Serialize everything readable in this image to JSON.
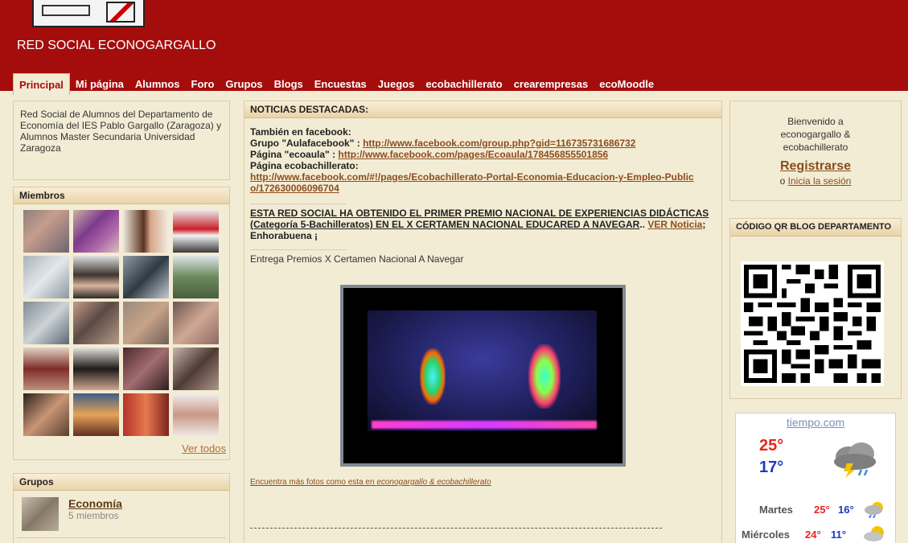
{
  "header": {
    "site_title": "RED SOCIAL ECONOGARGALLO"
  },
  "nav": {
    "tabs": [
      {
        "label": "Principal",
        "active": true
      },
      {
        "label": "Mi página"
      },
      {
        "label": "Alumnos"
      },
      {
        "label": "Foro"
      },
      {
        "label": "Grupos"
      },
      {
        "label": "Blogs"
      },
      {
        "label": "Encuestas"
      },
      {
        "label": "Juegos"
      },
      {
        "label": "ecobachillerato"
      },
      {
        "label": "crearempresas"
      },
      {
        "label": "ecoMoodle"
      }
    ]
  },
  "left": {
    "intro": "Red Social de Alumnos del Departamento de Economía del IES Pablo Gargallo (Zaragoza) y Alumnos Master Secundaria Universidad Zaragoza",
    "miembros_title": "Miembros",
    "ver_todos": "Ver todos",
    "grupos_title": "Grupos",
    "grupo": {
      "name": "Economía",
      "count": "5 miembros"
    }
  },
  "center": {
    "title": "NOTICIAS DESTACADAS:",
    "facebook_intro": "También en facebook:",
    "grupo_label": "Grupo \"Aulafacebook\" : ",
    "grupo_link": "http://www.facebook.com/group.php?gid=116735731686732",
    "pagina_label": "Página \"ecoaula\" : ",
    "pagina_link": "http://www.facebook.com/pages/Ecoaula/178456855501856",
    "ecobach_label": "Página ecobachillerato:",
    "ecobach_link": "http://www.facebook.com/#!/pages/Ecobachillerato-Portal-Economia-Educacion-y-Empleo-Publico/172630006096704",
    "dots": "......................................................",
    "premio": "ESTA RED SOCIAL HA OBTENIDO EL PRIMER PREMIO NACIONAL DE EXPERIENCIAS DIDÁCTICAS (Categoría 5-Bachilleratos) EN EL X CERTAMEN NACIONAL EDUCARED A NAVEGAR",
    "premio_sep": ".. ",
    "ver_noticia": "VER Noticia",
    "enhorabuena": "; Enhorabuena ¡",
    "entrega": "Entrega Premios X Certamen Nacional A Navegar",
    "mas_fotos_pre": "Encuentra más fotos como esta en ",
    "mas_fotos_site": "econogargallo & ecobachillerato"
  },
  "right": {
    "bienvenido_1": "Bienvenido a",
    "bienvenido_2": "econogargallo &",
    "bienvenido_3": "ecobachillerato",
    "registrarse": "Registrarse",
    "sesion_pre": "o ",
    "sesion_link": "Inicia la sesión",
    "qr_title": "CÓDIGO QR BLOG DEPARTAMENTO",
    "weather": {
      "site": "tiempo.com",
      "today_max": "25°",
      "today_min": "17°",
      "days": [
        {
          "name": "Martes",
          "max": "25°",
          "min": "16°"
        },
        {
          "name": "Miércoles",
          "max": "24°",
          "min": "11°"
        }
      ],
      "color_max": "#e8241f",
      "color_min": "#1e37c9"
    }
  }
}
